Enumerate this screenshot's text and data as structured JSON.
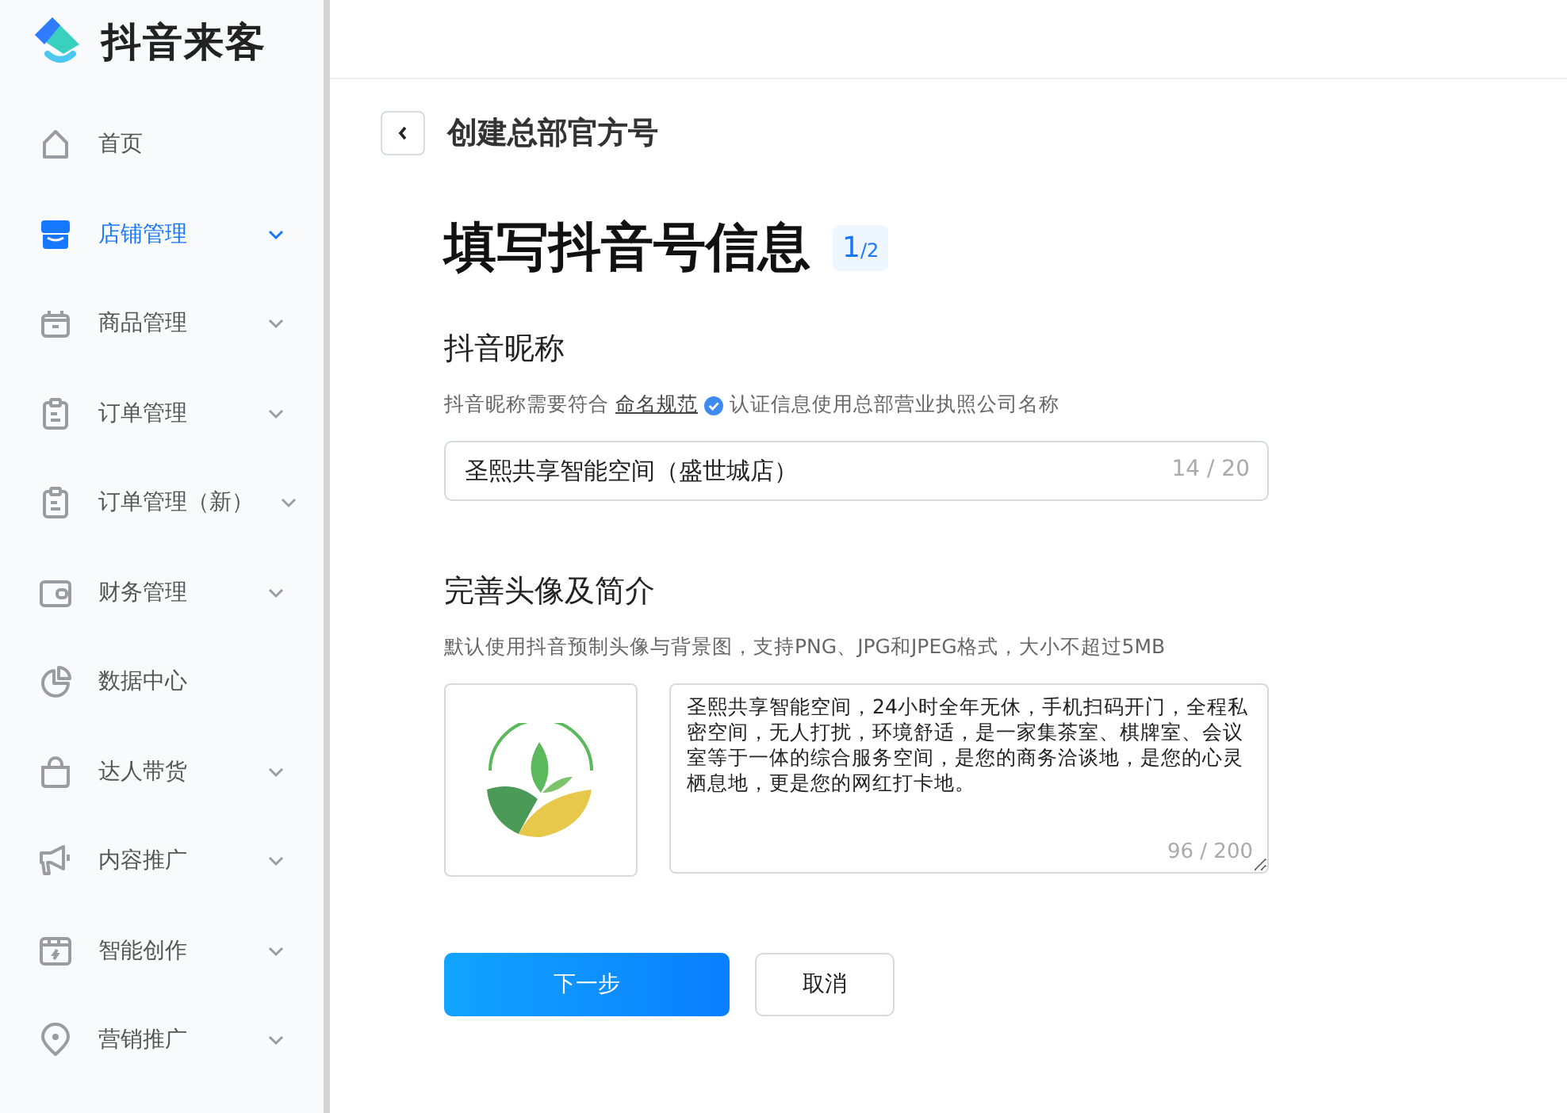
{
  "brand": {
    "name": "抖音来客"
  },
  "sidebar": {
    "items": [
      {
        "label": "首页",
        "selected": false
      },
      {
        "label": "店铺管理",
        "selected": true,
        "expanded": false
      },
      {
        "label": "商品管理",
        "selected": false,
        "expanded": false
      },
      {
        "label": "订单管理",
        "selected": false,
        "expanded": false
      },
      {
        "label": "订单管理（新）",
        "selected": false,
        "expanded": false
      },
      {
        "label": "财务管理",
        "selected": false,
        "expanded": false
      },
      {
        "label": "数据中心",
        "selected": false
      },
      {
        "label": "达人带货",
        "selected": false,
        "expanded": false
      },
      {
        "label": "内容推广",
        "selected": false,
        "expanded": false
      },
      {
        "label": "智能创作",
        "selected": false,
        "expanded": false
      },
      {
        "label": "营销推广",
        "selected": false,
        "expanded": false
      }
    ]
  },
  "page": {
    "title": "创建总部官方号",
    "heading": "填写抖音号信息",
    "step": "1",
    "step_total": "/2"
  },
  "nickname": {
    "label": "抖音昵称",
    "hint": "抖音昵称需要符合",
    "hint_link": "命名规范",
    "hint_note": "认证信息使用总部营业执照公司名称",
    "value": "圣熙共享智能空间（盛世城店）",
    "counter": "14 / 20"
  },
  "profile": {
    "label": "完善头像及简介",
    "hint": "默认使用抖音预制头像与背景图，支持PNG、JPG和JPEG格式，大小不超过5MB",
    "bio": "圣熙共享智能空间，24小时全年无休，手机扫码开门，全程私密空间，无人打扰，环境舒适，是一家集茶室、棋牌室、会议室等于一体的综合服务空间，是您的商务洽谈地，是您的心灵栖息地，更是您的网红打卡地。",
    "counter": "96 / 200"
  },
  "buttons": [
    {
      "label": "下一步",
      "kind": "primary"
    },
    {
      "label": "取消",
      "kind": "secondary"
    }
  ]
}
